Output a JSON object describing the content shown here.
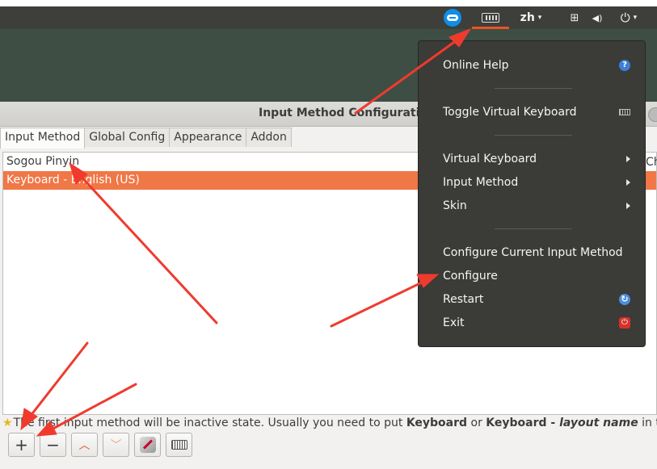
{
  "panel": {
    "language": "zh",
    "chevron": "▾",
    "network_glyph": "⊞",
    "volume_glyph": "◀)",
    "power_glyph": "⏻"
  },
  "window": {
    "title": "Input Method Configuration",
    "tabs": [
      {
        "label": "Input Method",
        "active": true
      },
      {
        "label": "Global Config",
        "active": false
      },
      {
        "label": "Appearance",
        "active": false
      },
      {
        "label": "Addon",
        "active": false
      }
    ],
    "column_header_partial": "Ch",
    "list": [
      {
        "label": "Sogou Pinyin",
        "selected": false
      },
      {
        "label": "Keyboard - English (US)",
        "selected": true
      }
    ],
    "hint": {
      "part1": "The first input method will be inactive state. Usually you need to put ",
      "bold1": "Keyboard",
      "part2": " or ",
      "bold2": "Keyboard - ",
      "italic": "layout name",
      "part3": " in the first pl"
    },
    "toolbar": {
      "add": "+",
      "remove": "−",
      "up": "︿",
      "down": "﹀"
    }
  },
  "menu": {
    "items": [
      {
        "label": "Online Help",
        "icon": "help-icon"
      },
      {
        "label": "Toggle Virtual Keyboard",
        "icon": "keyboard-icon"
      },
      {
        "label": "Virtual Keyboard",
        "icon": "submenu-arrow-icon"
      },
      {
        "label": "Input Method",
        "icon": "submenu-arrow-icon"
      },
      {
        "label": "Skin",
        "icon": "submenu-arrow-icon"
      },
      {
        "label": "Configure Current Input Method",
        "icon": ""
      },
      {
        "label": "Configure",
        "icon": ""
      },
      {
        "label": "Restart",
        "icon": "restart-icon"
      },
      {
        "label": "Exit",
        "icon": "exit-icon"
      }
    ],
    "help_glyph": "?",
    "restart_glyph": "↻",
    "exit_glyph": "⏻"
  },
  "colors": {
    "accent": "#e95420",
    "selection": "#f07746",
    "annotation_arrow": "#f03a2e"
  }
}
